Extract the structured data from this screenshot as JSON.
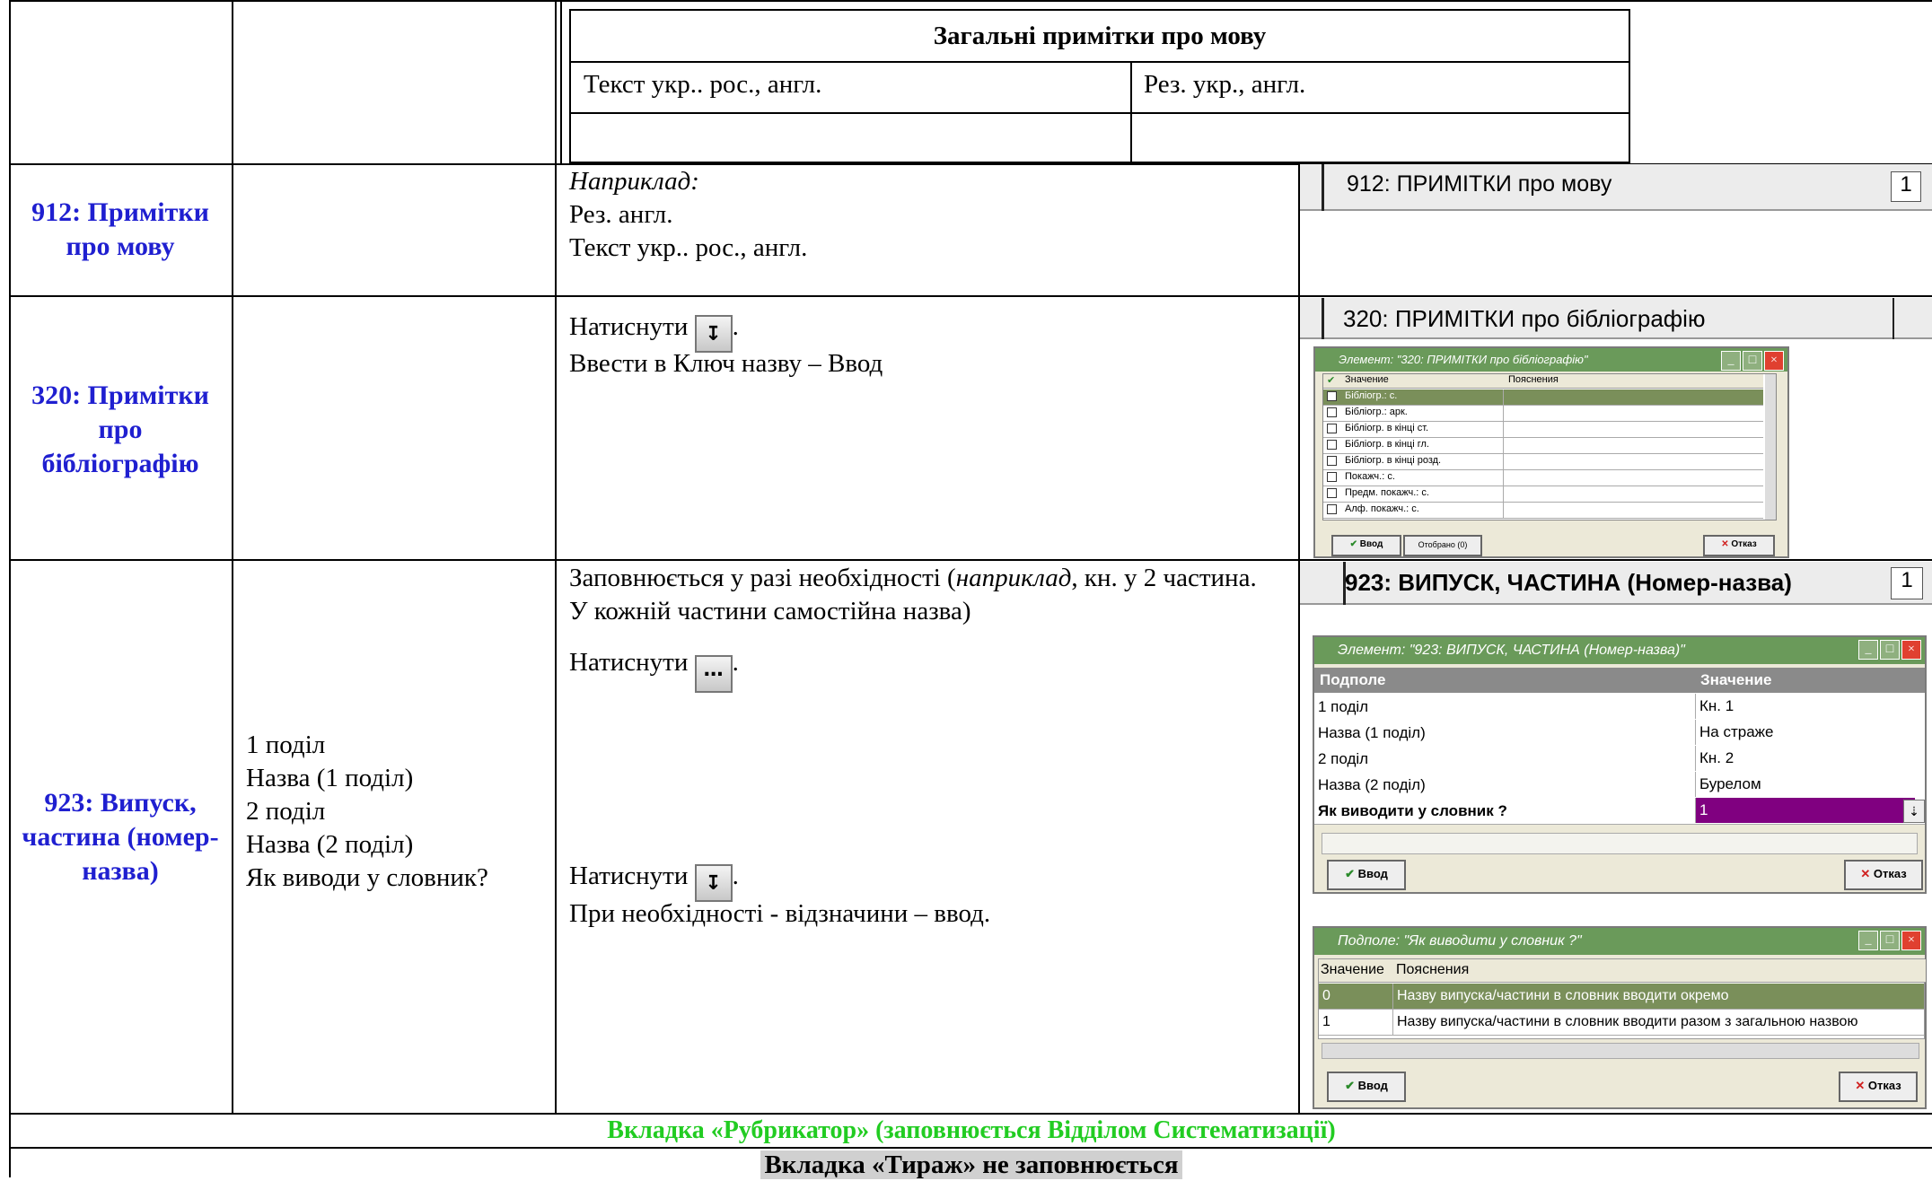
{
  "lang_table": {
    "title": "Загальні примітки про мову",
    "cell1": "Текст укр.. рос., англ.",
    "cell2": "Рез. укр., англ."
  },
  "rows": [
    {
      "field": "912: Примітки про мову",
      "example_label": "Наприклад:",
      "lines": [
        "Рез. англ.",
        "Текст укр.. рос., англ."
      ],
      "screenshot_label": "912: ПРИМІТКИ про мову",
      "screenshot_count": "1"
    },
    {
      "field": "320: Примітки про бібліографію",
      "press": "Натиснути",
      "after_press": ".",
      "line2": "Ввести в Ключ назву – Ввод",
      "screenshot_label": "320: ПРИМІТКИ про бібліографію",
      "dialog": {
        "title": "Элемент: \"320: ПРИМІТКИ про бібліографію\"",
        "col1": "Значение",
        "col2": "Пояснения",
        "items": [
          "Бібліогр.: с.",
          "Бібліогр.: арк.",
          "Бібліогр. в кінці ст.",
          "Бібліогр. в кінці гл.",
          "Бібліогр. в кінці розд.",
          "Покажч.: с.",
          "Предм. покажч.: с.",
          "Алф. покажч.: с."
        ],
        "ok": "Ввод",
        "selected": "Отобрано (0)",
        "cancel": "Отказ"
      }
    },
    {
      "field": "923: Випуск, частина (номер-назва)",
      "subfields": [
        "1 поділ",
        "Назва (1 поділ)",
        "2 поділ",
        "Назва (2 поділ)",
        "Як виводи у словник?"
      ],
      "note_start": "Заповнюється у разі необхідності (",
      "note_italic": "наприклад",
      "note_end": ", кн. у 2 частина. У кожній частини самостійна назва)",
      "press1": "Натиснути",
      "press2": "Натиснути",
      "after_press": ".",
      "final": "При необхідності - відзначини – ввод.",
      "screenshot_label": "923: ВИПУСК, ЧАСТИНА (Номер-назва)",
      "screenshot_count": "1",
      "dialog1": {
        "title": "Элемент: \"923: ВИПУСК, ЧАСТИНА (Номер-назва)\"",
        "col1": "Подполе",
        "col2": "Значение",
        "rows": [
          {
            "k": "1 поділ",
            "v": "Кн. 1"
          },
          {
            "k": "Назва (1 поділ)",
            "v": "На страже"
          },
          {
            "k": "2 поділ",
            "v": "Кн. 2"
          },
          {
            "k": "Назва (2 поділ)",
            "v": "Бурелом"
          },
          {
            "k": "Як виводити у словник ?",
            "v": "1"
          }
        ],
        "ok": "Ввод",
        "cancel": "Отказ"
      },
      "dialog2": {
        "title": "Подполе: \"Як виводити у словник ?\"",
        "col1": "Значение",
        "col2": "Пояснения",
        "rows": [
          {
            "k": "0",
            "v": "Назву випуска/частини в словник вводити окремо"
          },
          {
            "k": "1",
            "v": "Назву випуска/частини в словник вводити разом з загальною назвою"
          }
        ],
        "ok": "Ввод",
        "cancel": "Отказ"
      }
    }
  ],
  "footer": {
    "rubricator": "Вкладка «Рубрикатор» (заповнюється Відділом Систематизації)",
    "tirazh": "Вкладка «Тираж» не заповнюється"
  },
  "colors": {
    "field_blue": "#1f1fd0",
    "green": "#22cc22",
    "selected_row": "#7a8f5a",
    "value_purple": "#800080"
  },
  "icons": {
    "dropdown": "down-arrow-icon",
    "ellipsis": "ellipsis-icon"
  }
}
